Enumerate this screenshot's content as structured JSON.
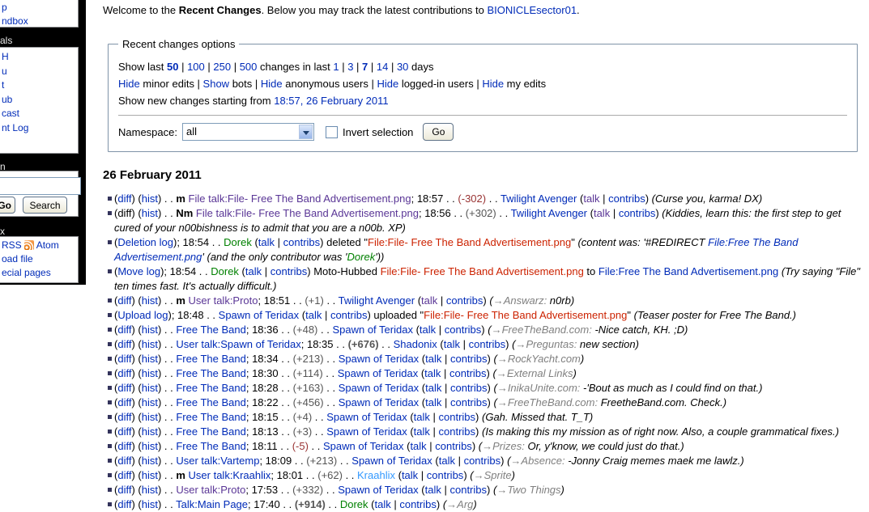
{
  "colors": {
    "link": "#002bb8",
    "visited_link": "#5a3696",
    "red_link": "#cc2200",
    "user_green": "#008000",
    "user_cyan": "#3399ff",
    "size_negative": "#993333",
    "size_positive": "#555555",
    "autocomment_gray": "#808080",
    "bullet": "#34345c",
    "rss_orange": "#e06d00",
    "sidebar_bg": "#000000"
  },
  "sidebar": {
    "box1_items": [
      "p",
      "ndbox"
    ],
    "header_portals": "als",
    "box2_items": [
      "H",
      "",
      "u",
      "t",
      "ub",
      "cast",
      "nt Log"
    ],
    "header_search": "n",
    "search": {
      "input_value": "",
      "go_label": "Go",
      "search_label": "Search"
    },
    "header_toolbox": "x",
    "feeds": [
      [
        "l",
        "RSS"
      ],
      [
        "rss",
        ""
      ],
      [
        "l",
        "Atom"
      ]
    ],
    "box4_items": [
      "oad file",
      "ecial pages"
    ]
  },
  "intro": [
    [
      "p",
      "Welcome to the "
    ],
    [
      "b",
      "Recent Changes"
    ],
    [
      "p",
      ". Below you may track the latest contributions to "
    ],
    [
      "l",
      "BIONICLEsector01"
    ],
    [
      "p",
      "."
    ]
  ],
  "options": {
    "legend": "Recent changes options",
    "lines": [
      [
        [
          "p",
          "Show last "
        ],
        [
          "lb",
          "50"
        ],
        [
          "p",
          " | "
        ],
        [
          "l",
          "100"
        ],
        [
          "p",
          " | "
        ],
        [
          "l",
          "250"
        ],
        [
          "p",
          " | "
        ],
        [
          "l",
          "500"
        ],
        [
          "p",
          " changes in last "
        ],
        [
          "l",
          "1"
        ],
        [
          "p",
          " | "
        ],
        [
          "l",
          "3"
        ],
        [
          "p",
          " | "
        ],
        [
          "lb",
          "7"
        ],
        [
          "p",
          " | "
        ],
        [
          "l",
          "14"
        ],
        [
          "p",
          " | "
        ],
        [
          "l",
          "30"
        ],
        [
          "p",
          " days"
        ]
      ],
      [
        [
          "l",
          "Hide"
        ],
        [
          "p",
          " minor edits | "
        ],
        [
          "l",
          "Show"
        ],
        [
          "p",
          " bots | "
        ],
        [
          "l",
          "Hide"
        ],
        [
          "p",
          " anonymous users | "
        ],
        [
          "l",
          "Hide"
        ],
        [
          "p",
          " logged-in users | "
        ],
        [
          "l",
          "Hide"
        ],
        [
          "p",
          " my edits"
        ]
      ],
      [
        [
          "p",
          "Show new changes starting from "
        ],
        [
          "l",
          "18:57, 26 February 2011"
        ]
      ]
    ],
    "namespace_label": "Namespace:",
    "namespace_value": "all",
    "invert_label": "Invert selection",
    "go_label": "Go"
  },
  "date_heading": "26 February 2011",
  "rows": [
    [
      [
        "p",
        "("
      ],
      [
        "l",
        "diff"
      ],
      [
        "p",
        ") ("
      ],
      [
        "l",
        "hist"
      ],
      [
        "p",
        ") . . "
      ],
      [
        "bm",
        "m "
      ],
      [
        "v",
        "File talk:File- Free The Band Advertisement.png"
      ],
      [
        "p",
        "; 18:57 . . "
      ],
      [
        "n",
        "(-302)"
      ],
      [
        "p",
        " . . "
      ],
      [
        "l",
        "Twilight Avenger"
      ],
      [
        "p",
        " ("
      ],
      [
        "v",
        "talk"
      ],
      [
        "p",
        " | "
      ],
      [
        "l",
        "contribs"
      ],
      [
        "p",
        ") "
      ],
      [
        "i",
        "(Curse you, karma! DX)"
      ]
    ],
    [
      [
        "p",
        "(diff) ("
      ],
      [
        "l",
        "hist"
      ],
      [
        "p",
        ") . . "
      ],
      [
        "bm",
        "Nm "
      ],
      [
        "v",
        "File talk:File- Free The Band Advertisement.png"
      ],
      [
        "p",
        "; 18:56 . . "
      ],
      [
        "o",
        "(+302)"
      ],
      [
        "p",
        " . . "
      ],
      [
        "l",
        "Twilight Avenger"
      ],
      [
        "p",
        " ("
      ],
      [
        "v",
        "talk"
      ],
      [
        "p",
        " | "
      ],
      [
        "l",
        "contribs"
      ],
      [
        "p",
        ") "
      ],
      [
        "i",
        "(Kiddies, learn this: the first step to get cured of your n00bishness is to admit that you are a n00b. XP)"
      ]
    ],
    [
      [
        "p",
        "("
      ],
      [
        "l",
        "Deletion log"
      ],
      [
        "p",
        "); 18:54 . . "
      ],
      [
        "g",
        "Dorek"
      ],
      [
        "p",
        " ("
      ],
      [
        "l",
        "talk"
      ],
      [
        "p",
        " | "
      ],
      [
        "l",
        "contribs"
      ],
      [
        "p",
        ") deleted \""
      ],
      [
        "r",
        "File:File- Free The Band Advertisement.png"
      ],
      [
        "p",
        "\" "
      ],
      [
        "i",
        "(content was: '#REDIRECT "
      ],
      [
        "li",
        "File:Free The Band Advertisement.png"
      ],
      [
        "i",
        "' (and the only contributor was '"
      ],
      [
        "gi",
        "Dorek"
      ],
      [
        "i",
        "'))"
      ]
    ],
    [
      [
        "p",
        "("
      ],
      [
        "l",
        "Move log"
      ],
      [
        "p",
        "); 18:54 . . "
      ],
      [
        "g",
        "Dorek"
      ],
      [
        "p",
        " ("
      ],
      [
        "l",
        "talk"
      ],
      [
        "p",
        " | "
      ],
      [
        "l",
        "contribs"
      ],
      [
        "p",
        ") Moto-Hubbed "
      ],
      [
        "r",
        "File:File- Free The Band Advertisement.png"
      ],
      [
        "p",
        " to "
      ],
      [
        "l",
        "File:Free The Band Advertisement.png"
      ],
      [
        "p",
        " "
      ],
      [
        "i",
        "(Try saying \"File\" ten times fast. It's actually difficult.)"
      ]
    ],
    [
      [
        "p",
        "("
      ],
      [
        "l",
        "diff"
      ],
      [
        "p",
        ") ("
      ],
      [
        "l",
        "hist"
      ],
      [
        "p",
        ") . . "
      ],
      [
        "bm",
        "m "
      ],
      [
        "v",
        "User talk:Proto"
      ],
      [
        "p",
        "; 18:51 . . "
      ],
      [
        "o",
        "(+1)"
      ],
      [
        "p",
        " . . "
      ],
      [
        "l",
        "Twilight Avenger"
      ],
      [
        "p",
        " ("
      ],
      [
        "v",
        "talk"
      ],
      [
        "p",
        " | "
      ],
      [
        "l",
        "contribs"
      ],
      [
        "p",
        ") "
      ],
      [
        "i",
        "("
      ],
      [
        "a",
        "→Answarz:"
      ],
      [
        "i",
        " n0rb)"
      ]
    ],
    [
      [
        "p",
        "("
      ],
      [
        "l",
        "Upload log"
      ],
      [
        "p",
        "); 18:48 . . "
      ],
      [
        "l",
        "Spawn of Teridax"
      ],
      [
        "p",
        " ("
      ],
      [
        "l",
        "talk"
      ],
      [
        "p",
        " | "
      ],
      [
        "l",
        "contribs"
      ],
      [
        "p",
        ") uploaded \""
      ],
      [
        "r",
        "File:File- Free The Band Advertisement.png"
      ],
      [
        "p",
        "\" "
      ],
      [
        "i",
        "(Teaser poster for Free The Band.)"
      ]
    ],
    [
      [
        "p",
        "("
      ],
      [
        "l",
        "diff"
      ],
      [
        "p",
        ") ("
      ],
      [
        "l",
        "hist"
      ],
      [
        "p",
        ") . . "
      ],
      [
        "l",
        "Free The Band"
      ],
      [
        "p",
        "; 18:36 . . "
      ],
      [
        "o",
        "(+48)"
      ],
      [
        "p",
        " . . "
      ],
      [
        "l",
        "Spawn of Teridax"
      ],
      [
        "p",
        " ("
      ],
      [
        "l",
        "talk"
      ],
      [
        "p",
        " | "
      ],
      [
        "l",
        "contribs"
      ],
      [
        "p",
        ") "
      ],
      [
        "i",
        "("
      ],
      [
        "a",
        "→FreeTheBand.com:"
      ],
      [
        "i",
        " -Nice catch, KH. ;D)"
      ]
    ],
    [
      [
        "p",
        "("
      ],
      [
        "l",
        "diff"
      ],
      [
        "p",
        ") ("
      ],
      [
        "l",
        "hist"
      ],
      [
        "p",
        ") . . "
      ],
      [
        "l",
        "User talk:Spawn of Teridax"
      ],
      [
        "p",
        "; 18:35 . . "
      ],
      [
        "ob",
        "(+676)"
      ],
      [
        "p",
        " . . "
      ],
      [
        "l",
        "Shadonix"
      ],
      [
        "p",
        " ("
      ],
      [
        "l",
        "talk"
      ],
      [
        "p",
        " | "
      ],
      [
        "l",
        "contribs"
      ],
      [
        "p",
        ") "
      ],
      [
        "i",
        "("
      ],
      [
        "a",
        "→Preguntas:"
      ],
      [
        "i",
        " new section)"
      ]
    ],
    [
      [
        "p",
        "("
      ],
      [
        "l",
        "diff"
      ],
      [
        "p",
        ") ("
      ],
      [
        "l",
        "hist"
      ],
      [
        "p",
        ") . . "
      ],
      [
        "l",
        "Free The Band"
      ],
      [
        "p",
        "; 18:34 . . "
      ],
      [
        "o",
        "(+213)"
      ],
      [
        "p",
        " . . "
      ],
      [
        "l",
        "Spawn of Teridax"
      ],
      [
        "p",
        " ("
      ],
      [
        "l",
        "talk"
      ],
      [
        "p",
        " | "
      ],
      [
        "l",
        "contribs"
      ],
      [
        "p",
        ") "
      ],
      [
        "i",
        "("
      ],
      [
        "a",
        "→RockYacht.com"
      ],
      [
        "i",
        ")"
      ]
    ],
    [
      [
        "p",
        "("
      ],
      [
        "l",
        "diff"
      ],
      [
        "p",
        ") ("
      ],
      [
        "l",
        "hist"
      ],
      [
        "p",
        ") . . "
      ],
      [
        "l",
        "Free The Band"
      ],
      [
        "p",
        "; 18:30 . . "
      ],
      [
        "o",
        "(+114)"
      ],
      [
        "p",
        " . . "
      ],
      [
        "l",
        "Spawn of Teridax"
      ],
      [
        "p",
        " ("
      ],
      [
        "l",
        "talk"
      ],
      [
        "p",
        " | "
      ],
      [
        "l",
        "contribs"
      ],
      [
        "p",
        ") "
      ],
      [
        "i",
        "("
      ],
      [
        "a",
        "→External Links"
      ],
      [
        "i",
        ")"
      ]
    ],
    [
      [
        "p",
        "("
      ],
      [
        "l",
        "diff"
      ],
      [
        "p",
        ") ("
      ],
      [
        "l",
        "hist"
      ],
      [
        "p",
        ") . . "
      ],
      [
        "l",
        "Free The Band"
      ],
      [
        "p",
        "; 18:28 . . "
      ],
      [
        "o",
        "(+163)"
      ],
      [
        "p",
        " . . "
      ],
      [
        "l",
        "Spawn of Teridax"
      ],
      [
        "p",
        " ("
      ],
      [
        "l",
        "talk"
      ],
      [
        "p",
        " | "
      ],
      [
        "l",
        "contribs"
      ],
      [
        "p",
        ") "
      ],
      [
        "i",
        "("
      ],
      [
        "a",
        "→InikaUnite.com:"
      ],
      [
        "i",
        " -'Bout as much as I could find on that.)"
      ]
    ],
    [
      [
        "p",
        "("
      ],
      [
        "l",
        "diff"
      ],
      [
        "p",
        ") ("
      ],
      [
        "l",
        "hist"
      ],
      [
        "p",
        ") . . "
      ],
      [
        "l",
        "Free The Band"
      ],
      [
        "p",
        "; 18:22 . . "
      ],
      [
        "o",
        "(+456)"
      ],
      [
        "p",
        " . . "
      ],
      [
        "l",
        "Spawn of Teridax"
      ],
      [
        "p",
        " ("
      ],
      [
        "l",
        "talk"
      ],
      [
        "p",
        " | "
      ],
      [
        "l",
        "contribs"
      ],
      [
        "p",
        ") "
      ],
      [
        "i",
        "("
      ],
      [
        "a",
        "→FreeTheBand.com:"
      ],
      [
        "i",
        " FreetheBand.com. Check.)"
      ]
    ],
    [
      [
        "p",
        "("
      ],
      [
        "l",
        "diff"
      ],
      [
        "p",
        ") ("
      ],
      [
        "l",
        "hist"
      ],
      [
        "p",
        ") . . "
      ],
      [
        "l",
        "Free The Band"
      ],
      [
        "p",
        "; 18:15 . . "
      ],
      [
        "o",
        "(+4)"
      ],
      [
        "p",
        " . . "
      ],
      [
        "l",
        "Spawn of Teridax"
      ],
      [
        "p",
        " ("
      ],
      [
        "l",
        "talk"
      ],
      [
        "p",
        " | "
      ],
      [
        "l",
        "contribs"
      ],
      [
        "p",
        ") "
      ],
      [
        "i",
        "(Gah. Missed that. T_T)"
      ]
    ],
    [
      [
        "p",
        "("
      ],
      [
        "l",
        "diff"
      ],
      [
        "p",
        ") ("
      ],
      [
        "l",
        "hist"
      ],
      [
        "p",
        ") . . "
      ],
      [
        "l",
        "Free The Band"
      ],
      [
        "p",
        "; 18:13 . . "
      ],
      [
        "o",
        "(+3)"
      ],
      [
        "p",
        " . . "
      ],
      [
        "l",
        "Spawn of Teridax"
      ],
      [
        "p",
        " ("
      ],
      [
        "l",
        "talk"
      ],
      [
        "p",
        " | "
      ],
      [
        "l",
        "contribs"
      ],
      [
        "p",
        ") "
      ],
      [
        "i",
        "(Is making this my mission as of right now. Also, a couple grammatical fixes.)"
      ]
    ],
    [
      [
        "p",
        "("
      ],
      [
        "l",
        "diff"
      ],
      [
        "p",
        ") ("
      ],
      [
        "l",
        "hist"
      ],
      [
        "p",
        ") . . "
      ],
      [
        "l",
        "Free The Band"
      ],
      [
        "p",
        "; 18:11 . . "
      ],
      [
        "n",
        "(-5)"
      ],
      [
        "p",
        " . . "
      ],
      [
        "l",
        "Spawn of Teridax"
      ],
      [
        "p",
        " ("
      ],
      [
        "l",
        "talk"
      ],
      [
        "p",
        " | "
      ],
      [
        "l",
        "contribs"
      ],
      [
        "p",
        ") "
      ],
      [
        "i",
        "("
      ],
      [
        "a",
        "→Prizes:"
      ],
      [
        "i",
        " Or, y'know, we could just do that.)"
      ]
    ],
    [
      [
        "p",
        "("
      ],
      [
        "l",
        "diff"
      ],
      [
        "p",
        ") ("
      ],
      [
        "l",
        "hist"
      ],
      [
        "p",
        ") . . "
      ],
      [
        "l",
        "User talk:Vartemp"
      ],
      [
        "p",
        "; 18:09 . . "
      ],
      [
        "o",
        "(+213)"
      ],
      [
        "p",
        " . . "
      ],
      [
        "l",
        "Spawn of Teridax"
      ],
      [
        "p",
        " ("
      ],
      [
        "l",
        "talk"
      ],
      [
        "p",
        " | "
      ],
      [
        "l",
        "contribs"
      ],
      [
        "p",
        ") "
      ],
      [
        "i",
        "("
      ],
      [
        "a",
        "→Absence:"
      ],
      [
        "i",
        " -Jonny Craig memes maek me lawlz.)"
      ]
    ],
    [
      [
        "p",
        "("
      ],
      [
        "l",
        "diff"
      ],
      [
        "p",
        ") ("
      ],
      [
        "l",
        "hist"
      ],
      [
        "p",
        ") . . "
      ],
      [
        "bm",
        "m "
      ],
      [
        "l",
        "User talk:Kraahlix"
      ],
      [
        "p",
        "; 18:01 . . "
      ],
      [
        "o",
        "(+62)"
      ],
      [
        "p",
        " . . "
      ],
      [
        "y",
        "Kraahlix"
      ],
      [
        "p",
        " ("
      ],
      [
        "l",
        "talk"
      ],
      [
        "p",
        " | "
      ],
      [
        "l",
        "contribs"
      ],
      [
        "p",
        ") "
      ],
      [
        "i",
        "("
      ],
      [
        "a",
        "→Sprite"
      ],
      [
        "i",
        ")"
      ]
    ],
    [
      [
        "p",
        "("
      ],
      [
        "l",
        "diff"
      ],
      [
        "p",
        ") ("
      ],
      [
        "l",
        "hist"
      ],
      [
        "p",
        ") . . "
      ],
      [
        "v",
        "User talk:Proto"
      ],
      [
        "p",
        "; 17:53 . . "
      ],
      [
        "o",
        "(+332)"
      ],
      [
        "p",
        " . . "
      ],
      [
        "l",
        "Spawn of Teridax"
      ],
      [
        "p",
        " ("
      ],
      [
        "l",
        "talk"
      ],
      [
        "p",
        " | "
      ],
      [
        "l",
        "contribs"
      ],
      [
        "p",
        ") "
      ],
      [
        "i",
        "("
      ],
      [
        "a",
        "→Two Things"
      ],
      [
        "i",
        ")"
      ]
    ],
    [
      [
        "p",
        "("
      ],
      [
        "l",
        "diff"
      ],
      [
        "p",
        ") ("
      ],
      [
        "l",
        "hist"
      ],
      [
        "p",
        ") . . "
      ],
      [
        "l",
        "Talk:Main Page"
      ],
      [
        "p",
        "; 17:40 . . "
      ],
      [
        "ob",
        "(+914)"
      ],
      [
        "p",
        " . . "
      ],
      [
        "g",
        "Dorek"
      ],
      [
        "p",
        " ("
      ],
      [
        "l",
        "talk"
      ],
      [
        "p",
        " | "
      ],
      [
        "l",
        "contribs"
      ],
      [
        "p",
        ") "
      ],
      [
        "i",
        "("
      ],
      [
        "a",
        "→Arg"
      ],
      [
        "i",
        ")"
      ]
    ]
  ]
}
